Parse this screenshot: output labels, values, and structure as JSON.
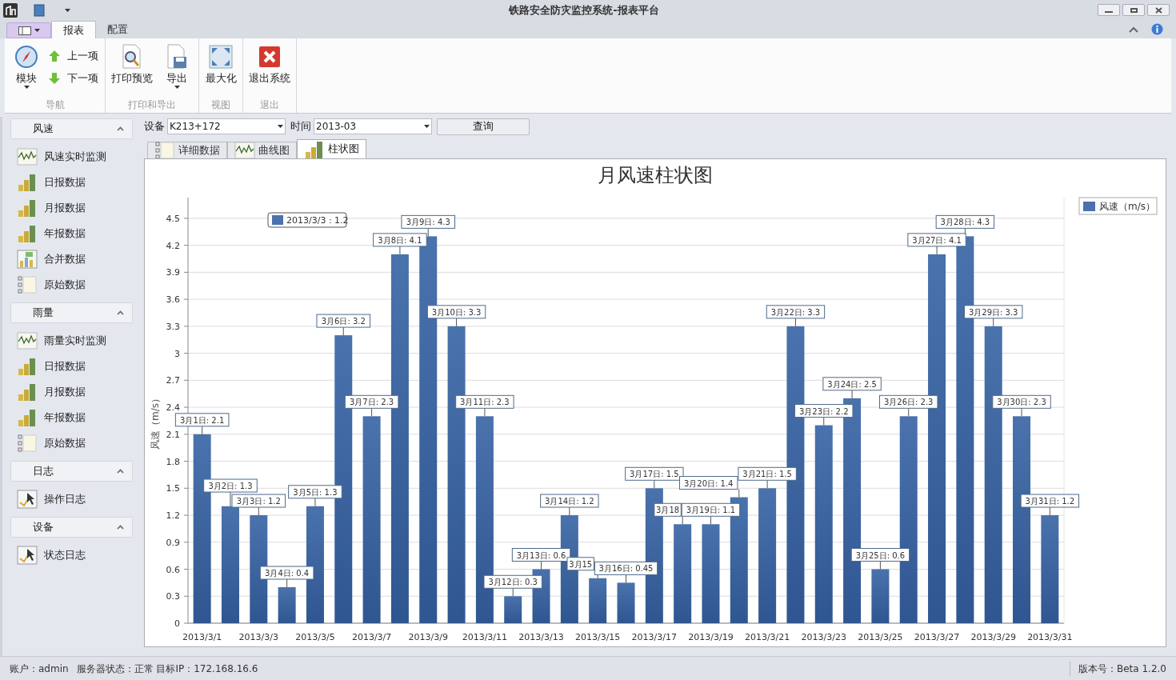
{
  "window": {
    "title": "铁路安全防灾监控系统-报表平台"
  },
  "ribbon": {
    "tabs": [
      {
        "label": "报表",
        "selected": true
      },
      {
        "label": "配置",
        "selected": false
      }
    ],
    "groups": [
      {
        "label": "导航",
        "items": [
          {
            "kind": "large",
            "label": "模块",
            "dropdown": true
          },
          {
            "kind": "small",
            "label": "上一项"
          },
          {
            "kind": "small",
            "label": "下一项"
          }
        ]
      },
      {
        "label": "打印和导出",
        "items": [
          {
            "kind": "large",
            "label": "打印预览",
            "dropdown": false
          },
          {
            "kind": "large",
            "label": "导出",
            "dropdown": true
          }
        ]
      },
      {
        "label": "视图",
        "items": [
          {
            "kind": "large",
            "label": "最大化",
            "dropdown": false
          }
        ]
      },
      {
        "label": "退出",
        "items": [
          {
            "kind": "large",
            "label": "退出系统",
            "dropdown": false
          }
        ]
      }
    ]
  },
  "sidebar": {
    "groups": [
      {
        "title": "风速",
        "expanded": true,
        "items": [
          {
            "kind": "wave",
            "label": "风速实时监测"
          },
          {
            "kind": "bars",
            "label": "日报数据"
          },
          {
            "kind": "bars",
            "label": "月报数据"
          },
          {
            "kind": "bars",
            "label": "年报数据"
          },
          {
            "kind": "merge",
            "label": "合并数据"
          },
          {
            "kind": "list",
            "label": "原始数据"
          }
        ]
      },
      {
        "title": "雨量",
        "expanded": true,
        "items": [
          {
            "kind": "wave",
            "label": "雨量实时监测"
          },
          {
            "kind": "bars",
            "label": "日报数据"
          },
          {
            "kind": "bars",
            "label": "月报数据"
          },
          {
            "kind": "bars",
            "label": "年报数据"
          },
          {
            "kind": "list",
            "label": "原始数据"
          }
        ]
      },
      {
        "title": "日志",
        "expanded": true,
        "items": [
          {
            "kind": "log",
            "label": "操作日志"
          }
        ]
      },
      {
        "title": "设备",
        "expanded": true,
        "items": [
          {
            "kind": "log",
            "label": "状态日志"
          }
        ]
      }
    ]
  },
  "filter": {
    "device_label": "设备",
    "device": "K213+172",
    "time_label": "时间",
    "time": "2013-03",
    "query_button": "查询"
  },
  "view_tabs": [
    {
      "label": "详细数据",
      "selected": false
    },
    {
      "label": "曲线图",
      "selected": false
    },
    {
      "label": "柱状图",
      "selected": true
    }
  ],
  "chart": {
    "tooltip": "2013/3/3 : 1.2",
    "chart_data": {
      "type": "bar",
      "title": "月风速柱状图",
      "ylabel": "风速（m/s）",
      "grid": true,
      "categories": [
        "2013/3/1",
        null,
        "2013/3/3",
        null,
        "2013/3/5",
        null,
        "2013/3/7",
        null,
        "2013/3/9",
        null,
        "2013/3/11",
        null,
        "2013/3/13",
        null,
        "2013/3/15",
        null,
        "2013/3/17",
        null,
        "2013/3/19",
        null,
        "2013/3/21",
        null,
        "2013/3/23",
        null,
        "2013/3/25",
        null,
        "2013/3/27",
        null,
        "2013/3/29",
        null,
        "2013/3/31"
      ],
      "series": [
        {
          "name": "风速（m/s）",
          "color": "#4a72ad",
          "values": [
            2.1,
            1.3,
            1.2,
            0.4,
            1.3,
            3.2,
            2.3,
            4.1,
            4.3,
            3.3,
            2.3,
            0.3,
            0.6,
            1.2,
            0.5,
            0.45,
            1.5,
            1.1,
            1.1,
            1.4,
            1.5,
            3.3,
            2.2,
            2.5,
            0.6,
            2.3,
            4.1,
            4.3,
            3.3,
            2.3,
            1.2
          ]
        }
      ],
      "value_labels": [
        "3月1日: 2.1",
        "3月2日: 1.3",
        "3月3日: 1.2",
        "3月4日: 0.4",
        "3月5日: 1.3",
        "3月6日: 3.2",
        "3月7日: 2.3",
        "3月8日: 4.1",
        "3月9日: 4.3",
        "3月10日: 3.3",
        "3月11日: 2.3",
        "3月12日: 0.3",
        "3月13日: 0.6",
        "3月14日: 1.2",
        "3月15",
        "3月16日: 0.45",
        "3月17日: 1.5",
        "3月18",
        "3月19日: 1.1",
        "3月20日: 1.4",
        "3月21日: 1.5",
        "3月22日: 3.3",
        "3月23日: 2.2",
        "3月24日: 2.5",
        "3月25日: 0.6",
        "3月26日: 2.3",
        "3月27日: 4.1",
        "3月28日: 4.3",
        "3月29日: 3.3",
        "3月30日: 2.3",
        "3月31日: 1.2"
      ],
      "ylim": [
        0,
        4.73
      ],
      "yticks": [
        {
          "value": 0,
          "label": "0"
        },
        {
          "value": 0.3,
          "label": "0.3"
        },
        {
          "value": 0.6,
          "label": "0.6"
        },
        {
          "value": 0.9,
          "label": "0.9"
        },
        {
          "value": 1.2,
          "label": "1.2"
        },
        {
          "value": 1.5,
          "label": "1.5"
        },
        {
          "value": 1.8,
          "label": "1.8"
        },
        {
          "value": 2.1,
          "label": "2.1"
        },
        {
          "value": 2.4,
          "label": "2.4"
        },
        {
          "value": 2.7,
          "label": "2.7"
        },
        {
          "value": 3,
          "label": "3"
        },
        {
          "value": 3.3,
          "label": "3.3"
        },
        {
          "value": 3.6,
          "label": "3.6"
        },
        {
          "value": 3.9,
          "label": "3.9"
        },
        {
          "value": 4.2,
          "label": "4.2"
        },
        {
          "value": 4.5,
          "label": "4.5"
        }
      ]
    }
  },
  "status_bar": {
    "account": "账户：admin",
    "server": "服务器状态：正常 目标IP：172.168.16.6",
    "version": "版本号：Beta 1.2.0"
  }
}
